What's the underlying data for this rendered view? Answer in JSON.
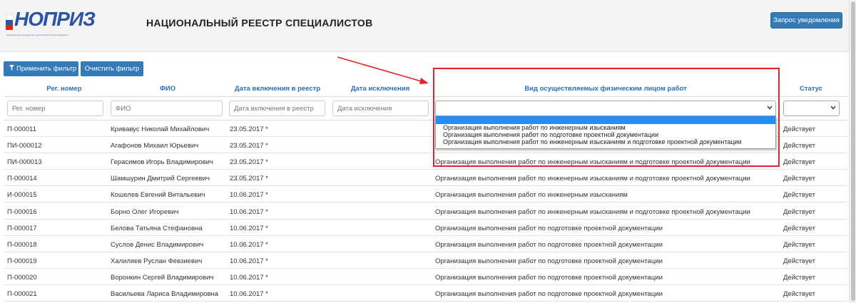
{
  "header": {
    "logo_text": "НОПРИЗ",
    "logo_subtitle": "Национальное объединение изыскателей и проектировщиков",
    "title": "НАЦИОНАЛЬНЫЙ РЕЕСТР СПЕЦИАЛИСТОВ",
    "notify_button": "Запрос уведомления"
  },
  "toolbar": {
    "apply_filter": "Применить фильтр",
    "clear_filter": "Очистить фильтр"
  },
  "columns": {
    "reg_number": "Рег. номер",
    "fio": "ФИО",
    "date_included": "Дата включения в реестр",
    "date_excluded": "Дата исключения",
    "work_type": "Вид осуществляемых физическим лицом работ",
    "status": "Статус"
  },
  "filters": {
    "reg_number_placeholder": "Рег. номер",
    "fio_placeholder": "ФИО",
    "date_included_placeholder": "Дата включения в реестр",
    "date_excluded_placeholder": "Дата исключения",
    "work_type_value": "",
    "status_value": ""
  },
  "dropdown": {
    "options": [
      "",
      "Организация выполнения работ по инженерным изысканиям",
      "Организация выполнения работ по подготовке проектной документации",
      "Организация выполнения работ по инженерным изысканиям и подготовке проектной документации"
    ]
  },
  "rows": [
    {
      "reg": "П-000011",
      "fio": "Кривавус Николай Михайлович",
      "date": "23.05.2017 *",
      "work": "",
      "status": "Действует"
    },
    {
      "reg": "ПИ-000012",
      "fio": "Агафонов Михаил Юрьевич",
      "date": "23.05.2017 *",
      "work": "",
      "status": "Действует"
    },
    {
      "reg": "ПИ-000013",
      "fio": "Герасимов Игорь Владимирович",
      "date": "23.05.2017 *",
      "work": "Организация выполнения работ по инженерным изысканиям и подготовке проектной документации",
      "status": "Действует"
    },
    {
      "reg": "П-000014",
      "fio": "Шамшурин Дмитрий Сергеевич",
      "date": "23.05.2017 *",
      "work": "Организация выполнения работ по инженерным изысканиям и подготовке проектной документации",
      "status": "Действует"
    },
    {
      "reg": "И-000015",
      "fio": "Кошелев Евгений Витальевич",
      "date": "10.06.2017 *",
      "work": "Организация выполнения работ по инженерным изысканиям",
      "status": "Действует"
    },
    {
      "reg": "П-000016",
      "fio": "Борно Олег Игоревич",
      "date": "10.06.2017 *",
      "work": "Организация выполнения работ по инженерным изысканиям и подготовке проектной документации",
      "status": "Действует"
    },
    {
      "reg": "П-000017",
      "fio": "Белова Татьяна Стефановна",
      "date": "10.06.2017 *",
      "work": "Организация выполнения работ по подготовке проектной документации",
      "status": "Действует"
    },
    {
      "reg": "П-000018",
      "fio": "Суслов Денис Владимирович",
      "date": "10.06.2017 *",
      "work": "Организация выполнения работ по подготовке проектной документации",
      "status": "Действует"
    },
    {
      "reg": "П-000019",
      "fio": "Халиляев Руслан Февзиевич",
      "date": "10.06.2017 *",
      "work": "Организация выполнения работ по подготовке проектной документации",
      "status": "Действует"
    },
    {
      "reg": "П-000020",
      "fio": "Воронкин Сергей Владимирович",
      "date": "10.06.2017 *",
      "work": "Организация выполнения работ по подготовке проектной документации",
      "status": "Действует"
    },
    {
      "reg": "П-000021",
      "fio": "Васильева Лариса Владимировна",
      "date": "10.06.2017 *",
      "work": "Организация выполнения работ по подготовке проектной документации",
      "status": "Действует"
    }
  ],
  "colors": {
    "primary": "#337ab7",
    "header_link": "#2a6fb5",
    "highlight": "#e0262a",
    "dropdown_selected": "#1e90ff"
  }
}
